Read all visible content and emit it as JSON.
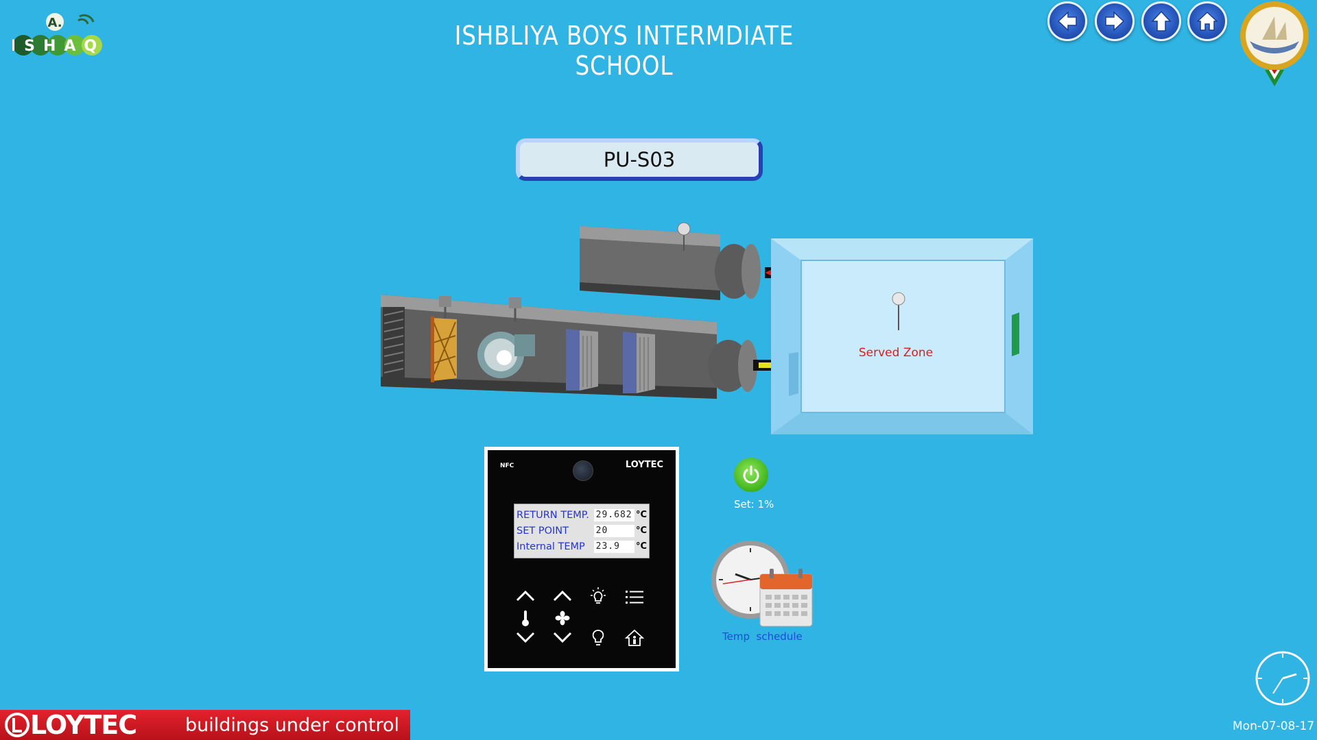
{
  "header": {
    "title": "ISHBLIYA BOYS INTERMDIATE SCHOOL",
    "logo_text": {
      "top": "A.",
      "bottom": "ISHAQ"
    },
    "nav": [
      {
        "id": "back",
        "icon": "arrow-left-icon"
      },
      {
        "id": "forward",
        "icon": "arrow-right-icon"
      },
      {
        "id": "up",
        "icon": "arrow-up-icon"
      },
      {
        "id": "home",
        "icon": "home-icon"
      }
    ]
  },
  "unit": {
    "name": "PU-S03"
  },
  "diagram": {
    "zone_label": "Served Zone"
  },
  "thermostat": {
    "nfc_label": "NFC",
    "brand": "LOYTEC",
    "readings": [
      {
        "label": "RETURN TEMP.",
        "value": "29.682",
        "unit": "°C"
      },
      {
        "label": "SET POINT",
        "value": "20",
        "unit": "°C"
      },
      {
        "label": "Internal TEMP",
        "value": "23.9",
        "unit": "°C"
      }
    ]
  },
  "power": {
    "set_text": "Set:  1%",
    "color": "#4cc22a"
  },
  "schedule": {
    "label": "Temp  schedule"
  },
  "footer": {
    "brand": "LOYTEC",
    "tagline": "buildings under control",
    "date": "Mon-07-08-17",
    "banner_color": "#d41c25"
  },
  "colors": {
    "background": "#2fb4e3",
    "accent": "#2840b0"
  }
}
